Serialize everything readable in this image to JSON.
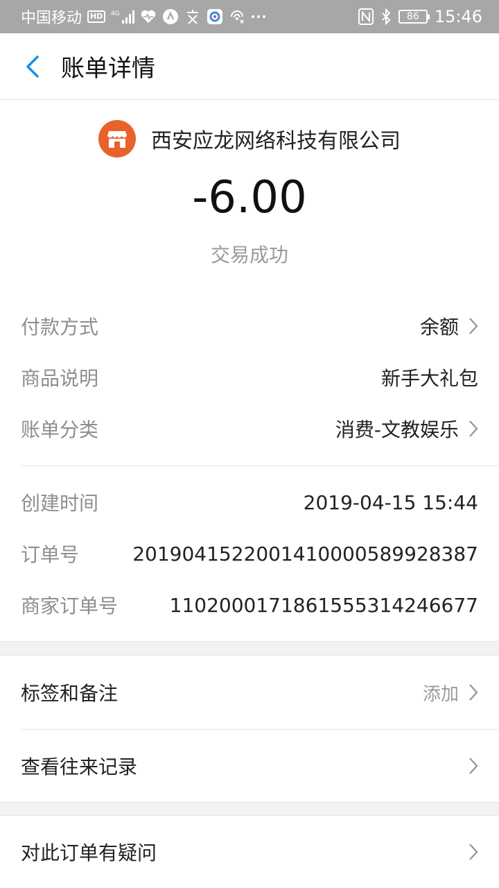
{
  "status_bar": {
    "carrier": "中国移动",
    "hd": "HD",
    "network": "4G",
    "battery": "86",
    "time": "15:46"
  },
  "header": {
    "title": "账单详情"
  },
  "merchant": {
    "name": "西安应龙网络科技有限公司",
    "amount": "-6.00",
    "status": "交易成功"
  },
  "details": [
    {
      "label": "付款方式",
      "value": "余额"
    },
    {
      "label": "商品说明",
      "value": "新手大礼包"
    },
    {
      "label": "账单分类",
      "value": "消费-文教娱乐"
    }
  ],
  "info": [
    {
      "label": "创建时间",
      "value": "2019-04-15 15:44"
    },
    {
      "label": "订单号",
      "value": "20190415220014100005899283​87"
    },
    {
      "label": "商家订单号",
      "value": "1102000171861555314246677"
    }
  ],
  "actions": {
    "tags": {
      "label": "标签和备注",
      "hint": "添加"
    },
    "history": {
      "label": "查看往来记录"
    },
    "question": {
      "label": "对此订单有疑问"
    }
  },
  "colors": {
    "accent": "#1a8fe3",
    "merchant_icon": "#e9622b",
    "status_bar": "#a7a7a7"
  }
}
